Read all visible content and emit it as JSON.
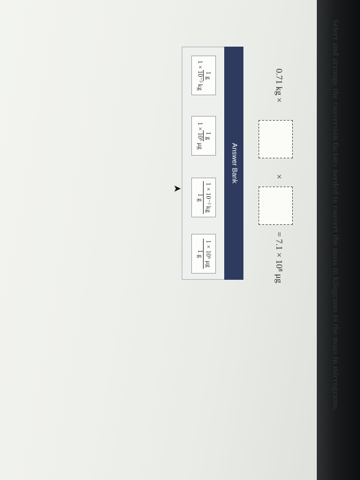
{
  "question": "Select and arrange the conversion factors needed to convert the mass in kilograms to the mass in micrograms.",
  "equation": {
    "given": "0.71 kg ×",
    "times": "×",
    "result": "= 7.1 × 10⁸ μg"
  },
  "answer_bank": {
    "title": "Answer Bank",
    "tiles": [
      {
        "num": "1 g",
        "den": "1 × 10⁻³ kg"
      },
      {
        "num": "1 g",
        "den": "1 × 10⁶ μg"
      },
      {
        "num": "1 × 10⁻³ kg",
        "den": "1 g"
      },
      {
        "num": "1 × 10⁶ μg",
        "den": "1 g"
      }
    ]
  }
}
